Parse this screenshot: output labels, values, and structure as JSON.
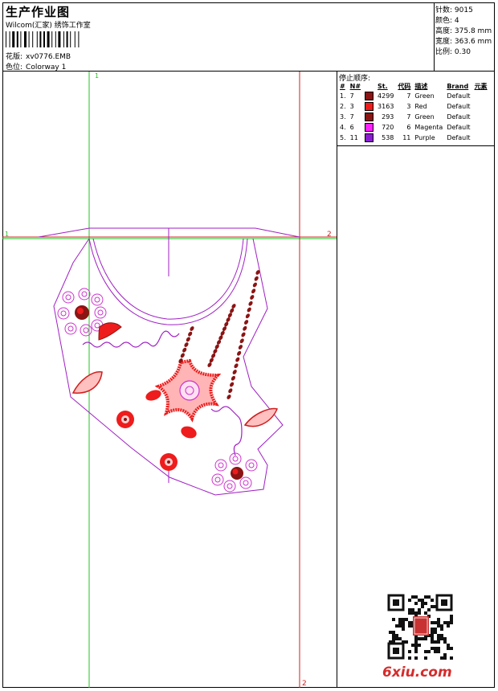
{
  "header": {
    "title": "生产作业图",
    "subtitle": "Wilcom(汇家) 绣饰工作室",
    "design_label": "花版:",
    "design_value": "xv0776.EMB",
    "colorway_label": "色位:",
    "colorway_value": "Colorway 1"
  },
  "stats": [
    {
      "label": "针数:",
      "value": "9015"
    },
    {
      "label": "颜色:",
      "value": "4"
    },
    {
      "label": "高度:",
      "value": "375.8 mm"
    },
    {
      "label": "宽度:",
      "value": "363.6 mm"
    },
    {
      "label": "比例:",
      "value": "0.30"
    }
  ],
  "stop_sequence": {
    "title": "停止顺序:",
    "columns": [
      "#",
      "N#",
      "St.",
      "代码",
      "描述",
      "Brand",
      "元素"
    ],
    "rows": [
      {
        "idx": "1.",
        "needle": "7",
        "color": "#8b1414",
        "stitches": "4299",
        "code": "7",
        "desc": "Green",
        "brand": "Default"
      },
      {
        "idx": "2.",
        "needle": "3",
        "color": "#ee1c1c",
        "stitches": "3163",
        "code": "3",
        "desc": "Red",
        "brand": "Default"
      },
      {
        "idx": "3.",
        "needle": "7",
        "color": "#8b1414",
        "stitches": "293",
        "code": "7",
        "desc": "Green",
        "brand": "Default"
      },
      {
        "idx": "4.",
        "needle": "6",
        "color": "#ff22ff",
        "stitches": "720",
        "code": "6",
        "desc": "Magenta",
        "brand": "Default"
      },
      {
        "idx": "5.",
        "needle": "11",
        "color": "#8a1dd0",
        "stitches": "538",
        "code": "11",
        "desc": "Purple",
        "brand": "Default"
      }
    ]
  },
  "guides": {
    "marker_1": "1",
    "marker_2": "2"
  },
  "watermark": {
    "text": "6xiu.com",
    "seal": "以图会友"
  },
  "colors": {
    "green_guide": "#22c322",
    "red_guide": "#d01e1e",
    "outline": "#a01fc4",
    "thread_red": "#ee1c1c",
    "thread_dark": "#8b1414",
    "magenta": "#cc33cc"
  }
}
